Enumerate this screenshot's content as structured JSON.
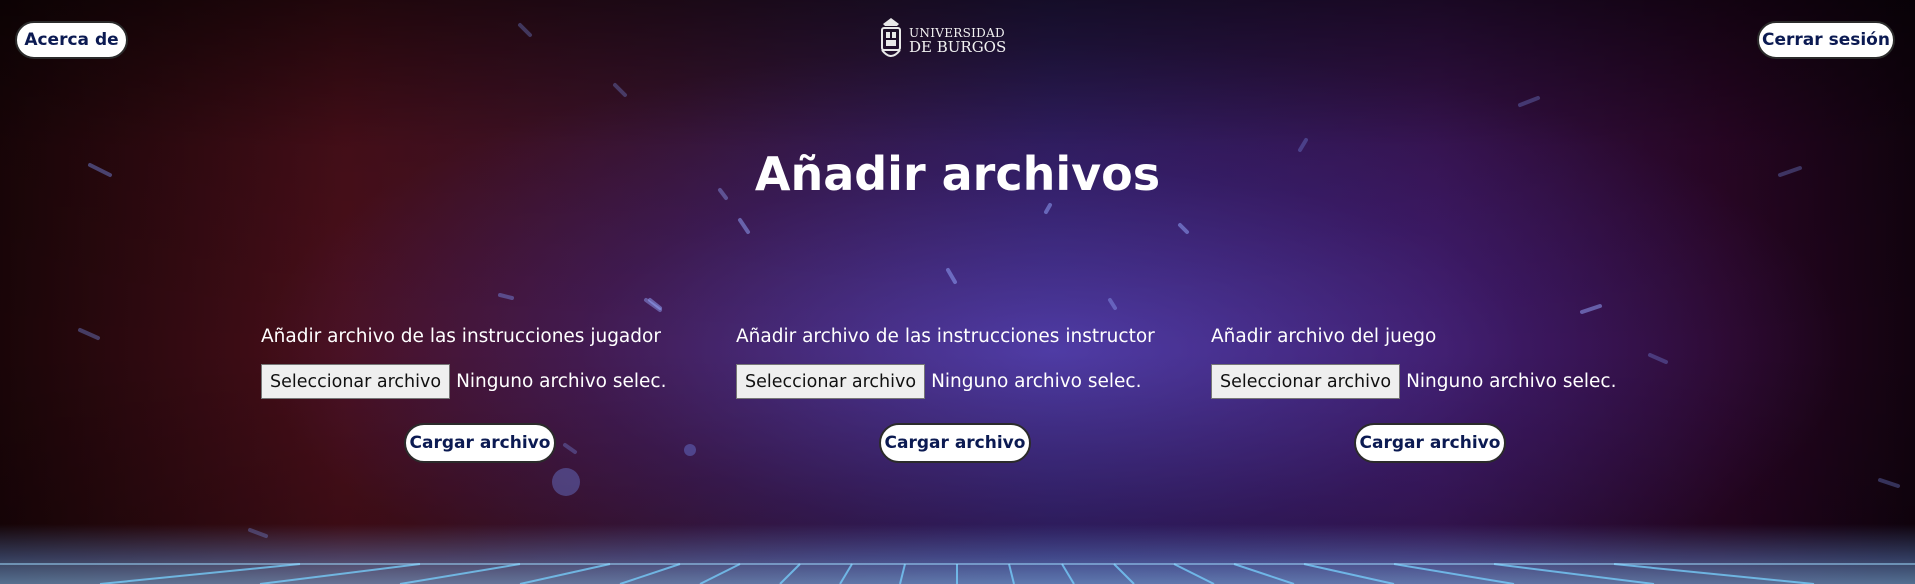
{
  "header": {
    "about_label": "Acerca de",
    "logout_label": "Cerrar sesión",
    "logo": {
      "line1": "UNIVERSIDAD",
      "line2": "DE BURGOS",
      "icon": "university-crest-icon"
    }
  },
  "main": {
    "title": "Añadir archivos",
    "uploads": [
      {
        "label": "Añadir archivo de las instrucciones jugador",
        "choose_label": "Seleccionar archivo",
        "status": "Ninguno archivo selec.",
        "submit_label": "Cargar archivo"
      },
      {
        "label": "Añadir archivo de las instrucciones instructor",
        "choose_label": "Seleccionar archivo",
        "status": "Ninguno archivo selec.",
        "submit_label": "Cargar archivo"
      },
      {
        "label": "Añadir archivo del juego",
        "choose_label": "Seleccionar archivo",
        "status": "Ninguno archivo selec.",
        "submit_label": "Cargar archivo"
      }
    ]
  },
  "colors": {
    "button_bg": "#ffffff",
    "button_text": "#0b1a52",
    "text": "#ffffff"
  }
}
